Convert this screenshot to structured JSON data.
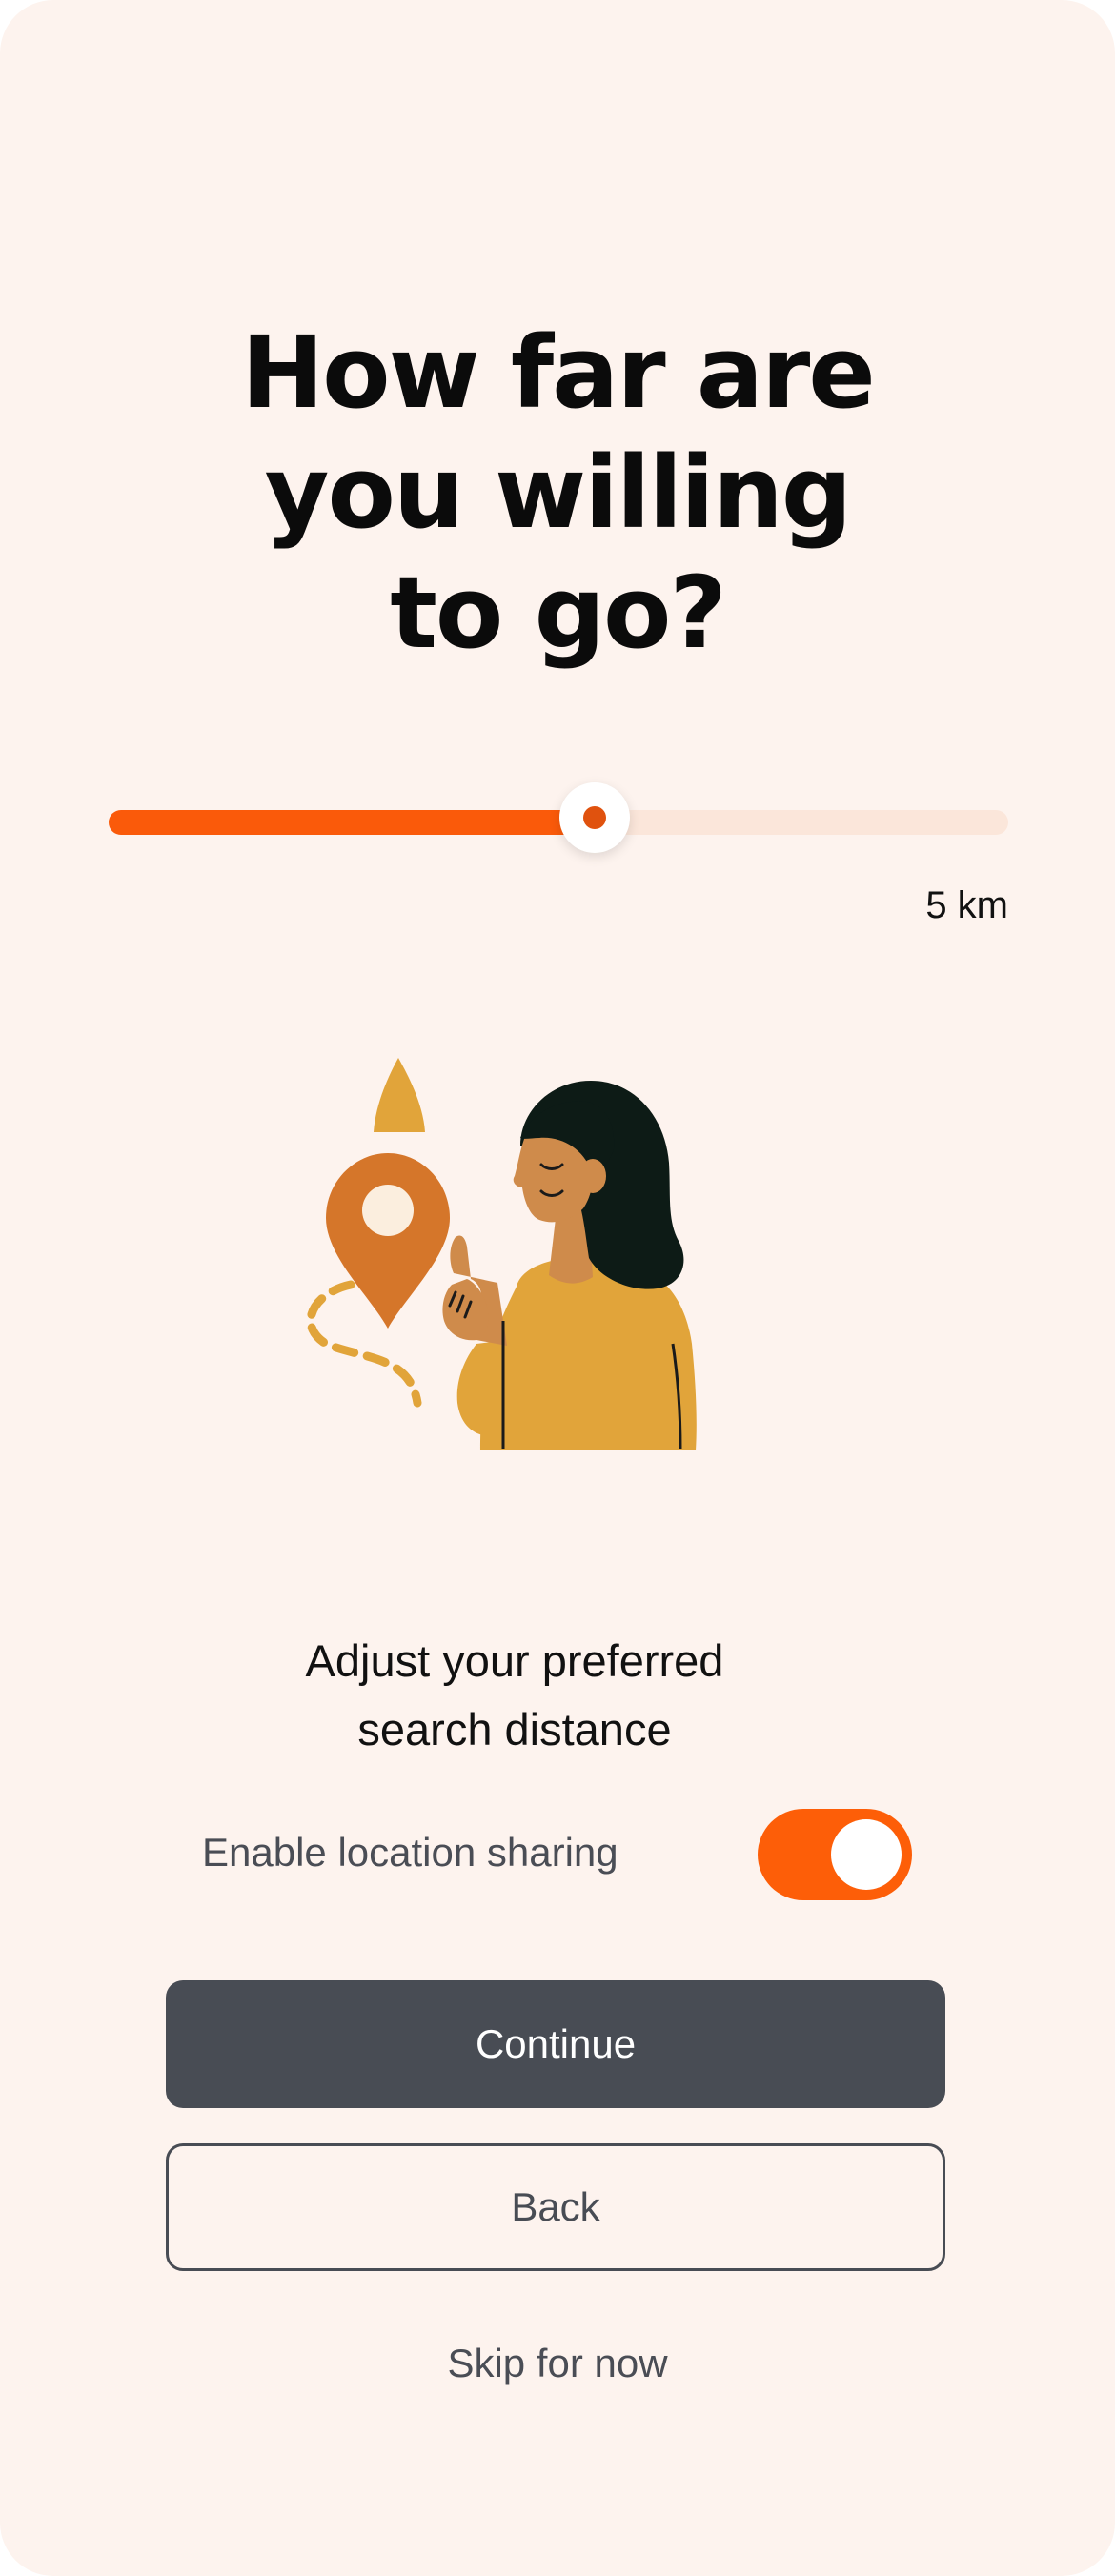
{
  "screen": {
    "title_lines": [
      "How far are",
      "you willing",
      "to go?"
    ],
    "subtitle_lines": [
      "Adjust your preferred",
      "search distance"
    ]
  },
  "distance_slider": {
    "value_label": "5 km",
    "level_fraction": 0.54,
    "fill_color": "#fa5a0a",
    "track_color": "#fbe6da"
  },
  "illustration": {
    "icon": "location-pin-woman-illustration",
    "pin_color": "#d5762a",
    "shirt_color": "#e1a43a"
  },
  "location_sharing": {
    "label": "Enable location sharing",
    "enabled": true,
    "toggle_color": "#fd5e08"
  },
  "actions": {
    "continue_label": "Continue",
    "back_label": "Back",
    "skip_label": "Skip for now"
  },
  "colors": {
    "background": "#fdf3ee",
    "primary_button": "#484c54"
  }
}
